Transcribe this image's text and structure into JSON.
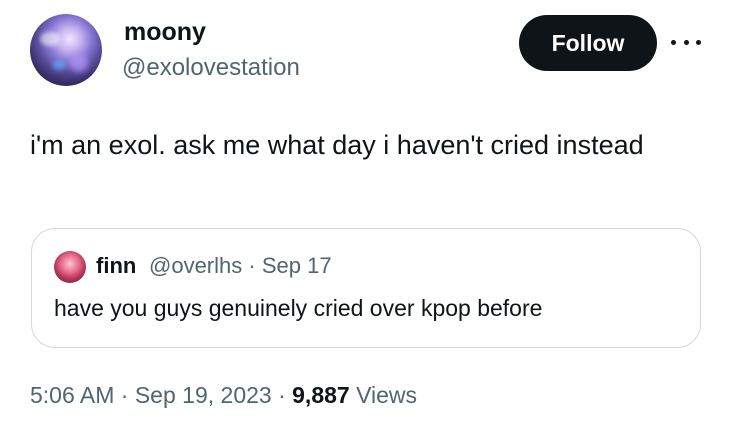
{
  "author": {
    "display_name": "moony",
    "handle": "@exolovestation",
    "avatar_icon": "profile-avatar"
  },
  "follow_label": "Follow",
  "more_icon": "more-options-icon",
  "tweet": {
    "text": "i'm an exol. ask me what day i haven't cried instead"
  },
  "quoted": {
    "display_name": "finn",
    "handle": "@overlhs",
    "separator": " · ",
    "date": "Sep 17",
    "text": "have you guys genuinely cried over kpop before"
  },
  "footer": {
    "time": "5:06 AM",
    "separator": " · ",
    "date": "Sep 19, 2023",
    "views_count": "9,887",
    "views_label": "Views"
  },
  "colors": {
    "text": "#0f1419",
    "secondary": "#536471",
    "button_bg": "#0f1419",
    "border": "#cfd9de"
  }
}
